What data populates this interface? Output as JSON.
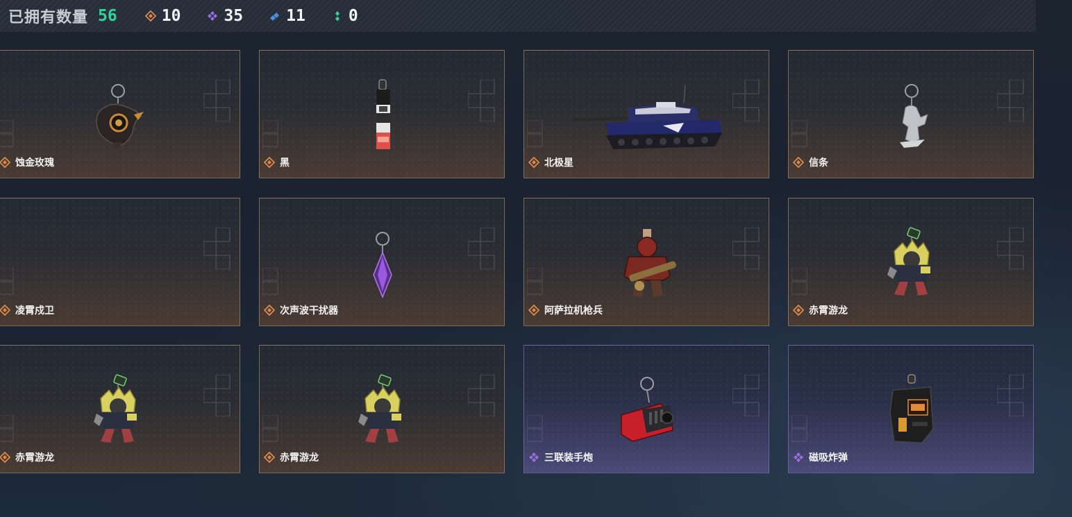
{
  "header": {
    "owned_label": "已拥有数量",
    "owned_count": "56",
    "stats": [
      {
        "icon": "orange-diamond-icon",
        "color": "#e08a4a",
        "value": "10"
      },
      {
        "icon": "purple-diamond-icon",
        "color": "#9b6ee0",
        "value": "35"
      },
      {
        "icon": "blue-diamond-icon",
        "color": "#4a8fe0",
        "value": "11"
      },
      {
        "icon": "green-diamond-icon",
        "color": "#3ccf9a",
        "value": "0"
      }
    ]
  },
  "items": [
    {
      "name": "蚀金玫瑰",
      "rarity": "orange",
      "art": "rose-pendant"
    },
    {
      "name": "黑",
      "rarity": "orange",
      "art": "black-tag"
    },
    {
      "name": "北极星",
      "rarity": "orange",
      "art": "tank"
    },
    {
      "name": "信条",
      "rarity": "orange",
      "art": "silver-charm"
    },
    {
      "name": "凌霄戍卫",
      "rarity": "orange",
      "art": "empty"
    },
    {
      "name": "次声波干扰器",
      "rarity": "orange",
      "art": "purple-crystal"
    },
    {
      "name": "阿萨拉机枪兵",
      "rarity": "orange",
      "art": "gunner-figure"
    },
    {
      "name": "赤霄游龙",
      "rarity": "orange",
      "art": "dragon-figure"
    },
    {
      "name": "赤霄游龙",
      "rarity": "orange",
      "art": "dragon-figure"
    },
    {
      "name": "赤霄游龙",
      "rarity": "orange",
      "art": "dragon-figure"
    },
    {
      "name": "三联装手炮",
      "rarity": "purple",
      "art": "hand-cannon"
    },
    {
      "name": "磁吸炸弹",
      "rarity": "purple",
      "art": "magnetic-bomb"
    }
  ]
}
